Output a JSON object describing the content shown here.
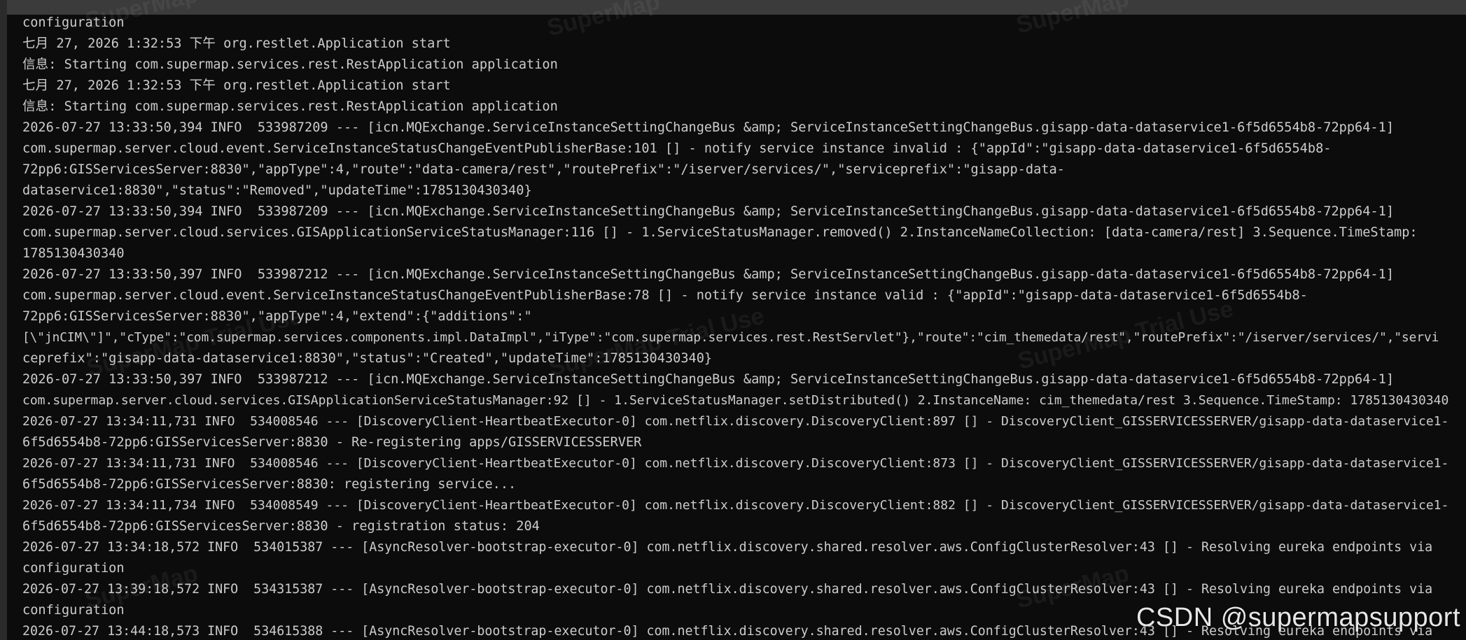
{
  "watermarks": [
    "SuperMap",
    "SuperMap",
    "SuperMap",
    "SuperMap Trial Use",
    "SuperMap Trial Use",
    "SuperMap Trial Use",
    "SuperMap",
    "SuperMap"
  ],
  "credit": "CSDN @supermapsupport",
  "lines": [
    "configuration",
    "七月 27, 2026 1:32:53 下午 org.restlet.Application start",
    "信息: Starting com.supermap.services.rest.RestApplication application",
    "七月 27, 2026 1:32:53 下午 org.restlet.Application start",
    "信息: Starting com.supermap.services.rest.RestApplication application",
    "2026-07-27 13:33:50,394 INFO  533987209 --- [icn.MQExchange.ServiceInstanceSettingChangeBus &amp; ServiceInstanceSettingChangeBus.gisapp-data-dataservice1-6f5d6554b8-72pp64-1]",
    "com.supermap.server.cloud.event.ServiceInstanceStatusChangeEventPublisherBase:101 [] - notify service instance invalid : {\"appId\":\"gisapp-data-dataservice1-6f5d6554b8-",
    "72pp6:GISServicesServer:8830\",\"appType\":4,\"route\":\"data-camera/rest\",\"routePrefix\":\"/iserver/services/\",\"serviceprefix\":\"gisapp-data-",
    "dataservice1:8830\",\"status\":\"Removed\",\"updateTime\":1785130430340}",
    "2026-07-27 13:33:50,394 INFO  533987209 --- [icn.MQExchange.ServiceInstanceSettingChangeBus &amp; ServiceInstanceSettingChangeBus.gisapp-data-dataservice1-6f5d6554b8-72pp64-1]",
    "com.supermap.server.cloud.services.GISApplicationServiceStatusManager:116 [] - 1.ServiceStatusManager.removed() 2.InstanceNameCollection: [data-camera/rest] 3.Sequence.TimeStamp:",
    "1785130430340",
    "2026-07-27 13:33:50,397 INFO  533987212 --- [icn.MQExchange.ServiceInstanceSettingChangeBus &amp; ServiceInstanceSettingChangeBus.gisapp-data-dataservice1-6f5d6554b8-72pp64-1]",
    "com.supermap.server.cloud.event.ServiceInstanceStatusChangeEventPublisherBase:78 [] - notify service instance valid : {\"appId\":\"gisapp-data-dataservice1-6f5d6554b8-",
    "72pp6:GISServicesServer:8830\",\"appType\":4,\"extend\":{\"additions\":\"",
    "[\\\"jnCIM\\\"]\",\"cType\":\"com.supermap.services.components.impl.DataImpl\",\"iType\":\"com.supermap.services.rest.RestServlet\"},\"route\":\"cim_themedata/rest\",\"routePrefix\":\"/iserver/services/\",\"servi",
    "ceprefix\":\"gisapp-data-dataservice1:8830\",\"status\":\"Created\",\"updateTime\":1785130430340}",
    "2026-07-27 13:33:50,397 INFO  533987212 --- [icn.MQExchange.ServiceInstanceSettingChangeBus &amp; ServiceInstanceSettingChangeBus.gisapp-data-dataservice1-6f5d6554b8-72pp64-1]",
    "com.supermap.server.cloud.services.GISApplicationServiceStatusManager:92 [] - 1.ServiceStatusManager.setDistributed() 2.InstanceName: cim_themedata/rest 3.Sequence.TimeStamp: 1785130430340",
    "2026-07-27 13:34:11,731 INFO  534008546 --- [DiscoveryClient-HeartbeatExecutor-0] com.netflix.discovery.DiscoveryClient:897 [] - DiscoveryClient_GISSERVICESSERVER/gisapp-data-dataservice1-",
    "6f5d6554b8-72pp6:GISServicesServer:8830 - Re-registering apps/GISSERVICESSERVER",
    "2026-07-27 13:34:11,731 INFO  534008546 --- [DiscoveryClient-HeartbeatExecutor-0] com.netflix.discovery.DiscoveryClient:873 [] - DiscoveryClient_GISSERVICESSERVER/gisapp-data-dataservice1-",
    "6f5d6554b8-72pp6:GISServicesServer:8830: registering service...",
    "2026-07-27 13:34:11,734 INFO  534008549 --- [DiscoveryClient-HeartbeatExecutor-0] com.netflix.discovery.DiscoveryClient:882 [] - DiscoveryClient_GISSERVICESSERVER/gisapp-data-dataservice1-",
    "6f5d6554b8-72pp6:GISServicesServer:8830 - registration status: 204",
    "2026-07-27 13:34:18,572 INFO  534015387 --- [AsyncResolver-bootstrap-executor-0] com.netflix.discovery.shared.resolver.aws.ConfigClusterResolver:43 [] - Resolving eureka endpoints via",
    "configuration",
    "2026-07-27 13:39:18,572 INFO  534315387 --- [AsyncResolver-bootstrap-executor-0] com.netflix.discovery.shared.resolver.aws.ConfigClusterResolver:43 [] - Resolving eureka endpoints via",
    "configuration",
    "2026-07-27 13:44:18,573 INFO  534615388 --- [AsyncResolver-bootstrap-executor-0] com.netflix.discovery.shared.resolver.aws.ConfigClusterResolver:43 [] - Resolving eureka endpoints via"
  ]
}
